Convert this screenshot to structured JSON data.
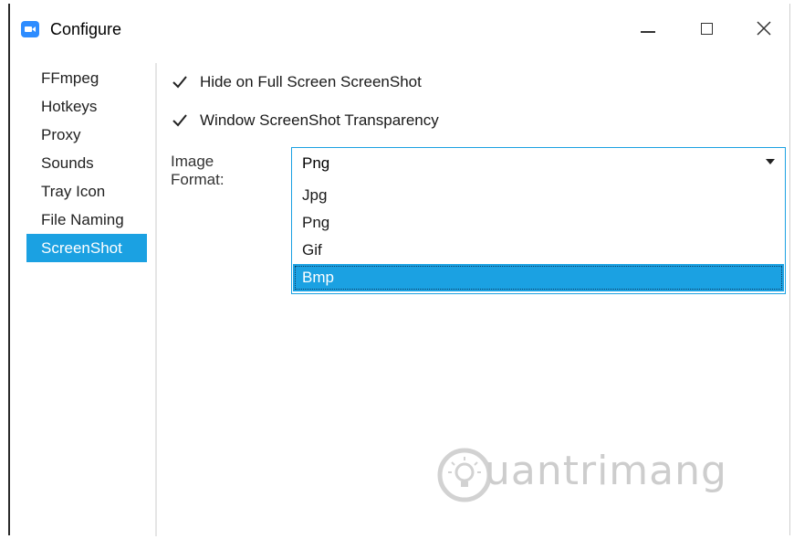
{
  "window": {
    "title": "Configure",
    "app_icon": "video-camera-icon",
    "controls": {
      "minimize_glyph": "",
      "maximize_glyph": "",
      "close_glyph": "✕"
    }
  },
  "sidebar": {
    "items": [
      {
        "label": "FFmpeg",
        "active": false
      },
      {
        "label": "Hotkeys",
        "active": false
      },
      {
        "label": "Proxy",
        "active": false
      },
      {
        "label": "Sounds",
        "active": false
      },
      {
        "label": "Tray Icon",
        "active": false
      },
      {
        "label": "File Naming",
        "active": false
      },
      {
        "label": "ScreenShot",
        "active": true
      }
    ]
  },
  "screenshot_settings": {
    "hide_fullscreen": {
      "label": "Hide on Full Screen ScreenShot",
      "checked": true
    },
    "window_transparency": {
      "label": "Window ScreenShot Transparency",
      "checked": true
    },
    "image_format": {
      "label": "Image Format:",
      "value": "Png",
      "options": [
        "Jpg",
        "Png",
        "Gif",
        "Bmp"
      ],
      "highlighted": "Bmp"
    }
  },
  "watermark": {
    "text": "uantrimang"
  },
  "colors": {
    "accent": "#1ba1e2",
    "app_icon": "#2d8cff"
  }
}
